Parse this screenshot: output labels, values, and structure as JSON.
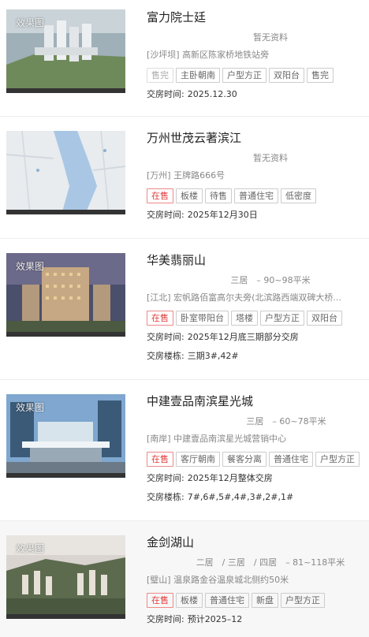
{
  "items": [
    {
      "image_tag": "效果图",
      "title": "富力院士廷",
      "layout": "暂无资料",
      "address": "[沙坪坝] 高新区陈家桥地铁站旁",
      "tags": [
        "售完",
        "主卧朝南",
        "户型方正",
        "双阳台",
        "售完"
      ],
      "delivery_label": "交房时间:",
      "delivery_value": "2025.12.30"
    },
    {
      "image_tag": "",
      "title": "万州世茂云著滨江",
      "layout": "暂无资料",
      "address": "[万州] 王牌路666号",
      "tags": [
        "在售",
        "板楼",
        "待售",
        "普通住宅",
        "低密度"
      ],
      "delivery_label": "交房时间:",
      "delivery_value": "2025年12月30日"
    },
    {
      "image_tag": "效果图",
      "title": "华美翡丽山",
      "layout": "三居　– 90~98平米",
      "address": "[江北] 宏帆路佰富高尔夫旁(北滨路西端双碑大桥...",
      "tags": [
        "在售",
        "卧室带阳台",
        "塔楼",
        "户型方正",
        "双阳台"
      ],
      "delivery_label": "交房时间:",
      "delivery_value": "2025年12月底三期部分交房",
      "building_label": "交房楼栋:",
      "building_value": "三期3#,42#"
    },
    {
      "image_tag": "效果图",
      "title": "中建壹品南滨星光城",
      "layout": "三居　– 60~78平米",
      "address": "[南岸] 中建壹品南滨星光城营销中心",
      "tags": [
        "在售",
        "客厅朝南",
        "餐客分离",
        "普通住宅",
        "户型方正"
      ],
      "delivery_label": "交房时间:",
      "delivery_value": "2025年12月整体交房",
      "building_label": "交房楼栋:",
      "building_value": "7#,6#,5#,4#,3#,2#,1#"
    },
    {
      "image_tag": "效果图",
      "title": "金剑湖山",
      "layout": "二居　/ 三居　/ 四居　– 81~118平米",
      "address": "[璧山] 温泉路金谷温泉城北侧约50米",
      "tags": [
        "在售",
        "板楼",
        "普通住宅",
        "新盘",
        "户型方正"
      ],
      "delivery_label": "交房时间:",
      "delivery_value": "预计2025–12"
    }
  ],
  "colors": {
    "sale_red": "#e03b3b",
    "text": "#333333",
    "muted": "#888888"
  }
}
